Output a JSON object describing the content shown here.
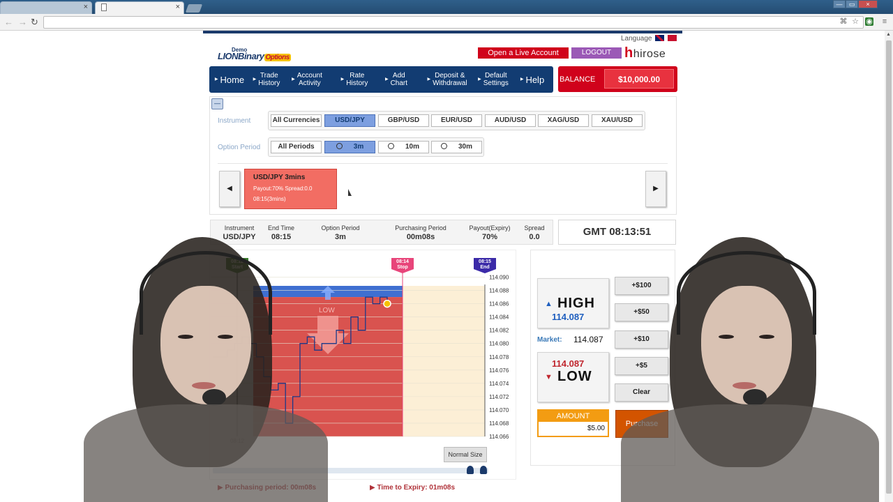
{
  "browser": {
    "tab2_close": "×",
    "tab1_close": "×",
    "back": "←",
    "forward": "→",
    "reload": "↻",
    "window_controls": [
      "—",
      "▭",
      "×"
    ]
  },
  "header": {
    "language_label": "Language",
    "logo_demo": "Demo",
    "logo_name": "LIONBinary",
    "logo_options": "Options",
    "open_live_account": "Open a Live Account",
    "logout": "LOGOUT",
    "brand_h": "h",
    "brand": "hirose"
  },
  "nav": {
    "items": [
      {
        "label": "Home"
      },
      {
        "label": "Trade\nHistory"
      },
      {
        "label": "Account\nActivity"
      },
      {
        "label": "Rate\nHistory"
      },
      {
        "label": "Add\nChart"
      },
      {
        "label": "Deposit &\nWithdrawal"
      },
      {
        "label": "Default\nSettings"
      },
      {
        "label": "Help"
      }
    ],
    "balance_label": "BALANCE",
    "balance_value": "$10,000.00"
  },
  "filters": {
    "instrument_label": "Instrument",
    "instruments": [
      "All Currencies",
      "USD/JPY",
      "GBP/USD",
      "EUR/USD",
      "AUD/USD",
      "XAG/USD",
      "XAU/USD"
    ],
    "selected_instrument": "USD/JPY",
    "period_label": "Option Period",
    "periods": [
      "All Periods",
      "3m",
      "10m",
      "30m"
    ],
    "selected_period": "3m"
  },
  "option_card": {
    "title": "USD/JPY   3mins",
    "line1": "Payout:70% Spread:0.0",
    "line2": "08:15(3mins)"
  },
  "info": {
    "columns": [
      {
        "head": "Instrument",
        "value": "USD/JPY"
      },
      {
        "head": "End Time",
        "value": "08:15"
      },
      {
        "head": "Option Period",
        "value": "3m"
      },
      {
        "head": "Purchasing Period",
        "value": "00m08s"
      },
      {
        "head": "Payout(Expiry)",
        "value": "70%"
      },
      {
        "head": "Spread",
        "value": "0.0"
      }
    ],
    "gmt": "GMT 08:13:51"
  },
  "chart": {
    "start_tag": "08:12\nStart",
    "stop_tag": "08:14\nStop",
    "end_tag": "08:15\nEnd",
    "x_label": "08:12",
    "low_overlay": "LOW",
    "normal_size": "Normal Size",
    "purchasing_period": "Purchasing period: 00m08s",
    "time_to_expiry": "Time to Expiry: 01m08s",
    "colors": {
      "low_zone": "#d9534f",
      "high_zone": "#3f6fd1",
      "after_stop": "#fcefd6",
      "line": "#1b3a8a"
    }
  },
  "chart_data": {
    "type": "line",
    "y_ticks": [
      "114.090",
      "114.088",
      "114.086",
      "114.084",
      "114.082",
      "114.080",
      "114.078",
      "114.076",
      "114.074",
      "114.072",
      "114.070",
      "114.068",
      "114.066"
    ],
    "ylim": [
      114.066,
      114.091
    ],
    "x_ticks": [
      "08:12"
    ],
    "series": [
      {
        "values": [
          114.078,
          114.078,
          114.079,
          114.08,
          114.081,
          114.08,
          114.078,
          114.075,
          114.073,
          114.074,
          114.068,
          114.072,
          114.08,
          114.081,
          114.079,
          114.08,
          114.08,
          114.082,
          114.08,
          114.084,
          114.082,
          114.087,
          114.086,
          114.087,
          114.086
        ]
      }
    ],
    "strike": 114.087
  },
  "trade": {
    "high_word": "HIGH",
    "high_price": "114.087",
    "market_label": "Market:",
    "market_value": "114.087",
    "low_price": "114.087",
    "low_word": "LOW",
    "amounts": [
      "+$100",
      "+$50",
      "+$10",
      "+$5",
      "Clear"
    ],
    "amount_label": "AMOUNT",
    "amount_value": "$5.00",
    "purchase": "Purchase"
  }
}
